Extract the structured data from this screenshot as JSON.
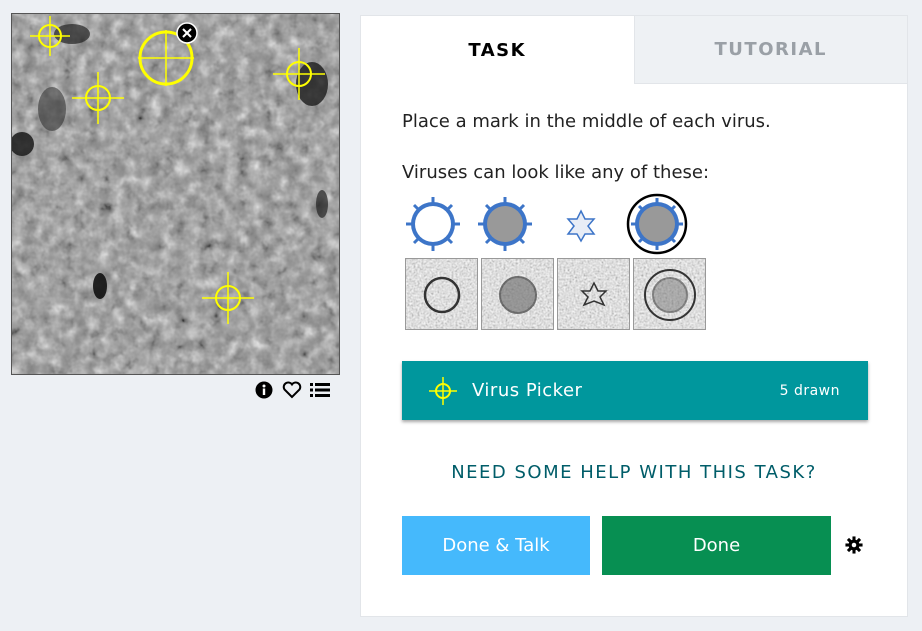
{
  "subject": {
    "image_alt": "Cryo-electron tomogram slice",
    "tools": [
      "info-icon",
      "heart-icon",
      "list-icon"
    ]
  },
  "task_panel": {
    "tabs": [
      {
        "label": "TASK",
        "active": true
      },
      {
        "label": "TUTORIAL",
        "active": false
      }
    ],
    "instruction": "Place a mark in the middle of each virus.",
    "examples_label": "Viruses can look like any of these:",
    "tool": {
      "label": "Virus Picker",
      "count": "5 drawn",
      "color": "#00979d",
      "icon": "crosshair-icon"
    },
    "help_link": "NEED SOME HELP WITH THIS TASK?",
    "buttons": {
      "done_talk": "Done & Talk",
      "done": "Done"
    }
  },
  "colors": {
    "background": "#edf0f4",
    "mark": "#ffff00",
    "done_talk": "#45b9fc",
    "done": "#078f52",
    "help_text": "#005d69"
  }
}
